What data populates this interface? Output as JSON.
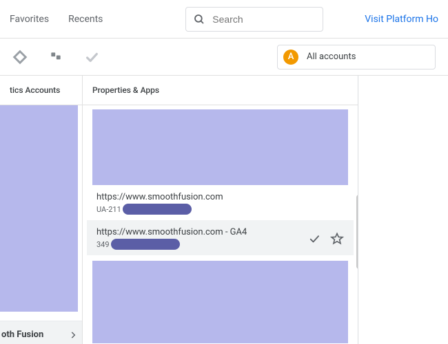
{
  "top": {
    "tabs": [
      "Favorites",
      "Recents"
    ],
    "search_placeholder": "Search",
    "visit_link": "Visit Platform Ho"
  },
  "iconbar": {
    "all_accounts_badge": "A",
    "all_accounts_label": "All accounts"
  },
  "left": {
    "header": "tics Accounts",
    "selected": "oth Fusion"
  },
  "mid": {
    "header": "Properties & Apps",
    "prop1": {
      "title": "https://www.smoothfusion.com",
      "id_prefix": "UA-211"
    },
    "prop2": {
      "title": "https://www.smoothfusion.com - GA4",
      "id_prefix": "349"
    }
  },
  "colors": {
    "redact": "#b6b8ec",
    "redact_pill": "#5b5ea6",
    "accent": "#1a73e8",
    "badge": "#f29900"
  }
}
